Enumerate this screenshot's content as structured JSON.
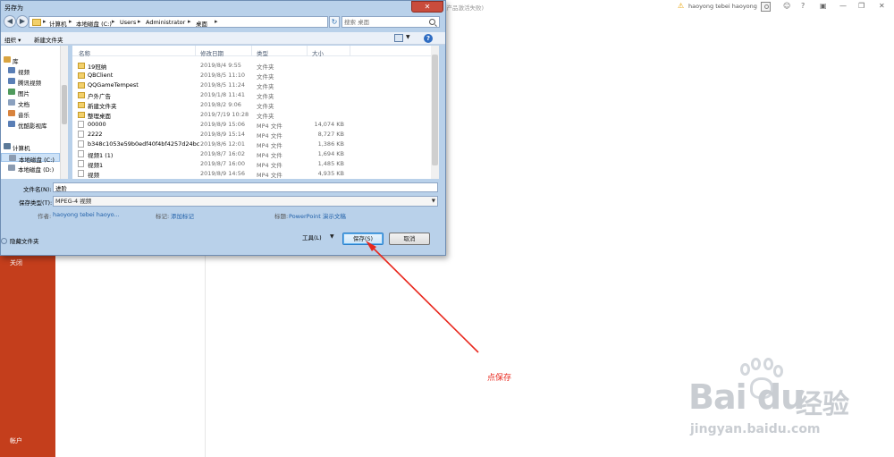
{
  "ppt": {
    "doc_title": "(产品激活失败)",
    "user_name": "haoyong tebei haoyong",
    "sidebar": {
      "close_label": "关闭",
      "account_label": "帐户"
    }
  },
  "dialog": {
    "title": "另存为",
    "address": {
      "crumbs": [
        "计算机",
        "本地磁盘 (C:)",
        "Users",
        "Administrator",
        "桌面"
      ]
    },
    "search_placeholder": "搜索 桌面",
    "toolbar": {
      "organize": "组织 ▾",
      "new_folder": "新建文件夹"
    },
    "nav": {
      "items": [
        {
          "label": "库",
          "icon": "library-icon",
          "top": true
        },
        {
          "label": "视频",
          "icon": "video-icon"
        },
        {
          "label": "腾讯视频",
          "icon": "video-icon"
        },
        {
          "label": "图片",
          "icon": "picture-icon"
        },
        {
          "label": "文档",
          "icon": "document-icon"
        },
        {
          "label": "音乐",
          "icon": "music-icon"
        },
        {
          "label": "优酷影视库",
          "icon": "video-icon"
        },
        {
          "label": "计算机",
          "icon": "computer-icon",
          "top": true
        },
        {
          "label": "本地磁盘 (C:)",
          "icon": "drive-icon",
          "selected": true
        },
        {
          "label": "本地磁盘 (D:)",
          "icon": "drive-icon"
        }
      ]
    },
    "list": {
      "headers": {
        "name": "名称",
        "date": "修改日期",
        "type": "类型",
        "size": "大小"
      },
      "rows": [
        {
          "name": "19冠纳",
          "date": "2019/8/4 9:55",
          "type": "文件夹",
          "size": "",
          "kind": "folder"
        },
        {
          "name": "QBClient",
          "date": "2019/8/5 11:10",
          "type": "文件夹",
          "size": "",
          "kind": "folder"
        },
        {
          "name": "QQGameTempest",
          "date": "2019/8/5 11:24",
          "type": "文件夹",
          "size": "",
          "kind": "folder"
        },
        {
          "name": "户外广告",
          "date": "2019/1/8 11:41",
          "type": "文件夹",
          "size": "",
          "kind": "folder"
        },
        {
          "name": "新建文件夹",
          "date": "2019/8/2 9:06",
          "type": "文件夹",
          "size": "",
          "kind": "folder"
        },
        {
          "name": "整理桌面",
          "date": "2019/7/19 10:28",
          "type": "文件夹",
          "size": "",
          "kind": "folder"
        },
        {
          "name": "00000",
          "date": "2019/8/9 15:06",
          "type": "MP4 文件",
          "size": "14,074 KB",
          "kind": "file"
        },
        {
          "name": "2222",
          "date": "2019/8/9 15:14",
          "type": "MP4 文件",
          "size": "8,727 KB",
          "kind": "file"
        },
        {
          "name": "b348c1053e59b0edf40f4bf4257d24bc",
          "date": "2019/8/6 12:01",
          "type": "MP4 文件",
          "size": "1,386 KB",
          "kind": "file"
        },
        {
          "name": "视频1 (1)",
          "date": "2019/8/7 16:02",
          "type": "MP4 文件",
          "size": "1,694 KB",
          "kind": "file"
        },
        {
          "name": "视频1",
          "date": "2019/8/7 16:00",
          "type": "MP4 文件",
          "size": "1,485 KB",
          "kind": "file"
        },
        {
          "name": "视频",
          "date": "2019/8/9 14:56",
          "type": "MP4 文件",
          "size": "4,935 KB",
          "kind": "file"
        }
      ]
    },
    "form": {
      "filename_label": "文件名(N):",
      "filename_value": "进阶",
      "filetype_label": "保存类型(T):",
      "filetype_value": "MPEG-4 视频",
      "author_label": "作者:",
      "author_value": "haoyong tebei haoyo...",
      "tags_label": "标记:",
      "tags_value": "添加标记",
      "title_label": "标题:",
      "title_value": "PowerPoint 演示文稿"
    },
    "footer": {
      "hide_folders": "隐藏文件夹",
      "tools": "工具(L)",
      "save": "保存(S)",
      "cancel": "取消"
    }
  },
  "annotation": {
    "text": "点保存",
    "color": "#e8281e"
  },
  "watermark": {
    "logo": "Bai du",
    "cn": "经验",
    "url": "jingyan.baidu.com"
  },
  "colors": {
    "ppt_accent": "#c43e1c",
    "dialog_chrome": "#b9d1ea",
    "close_button": "#c94c3c"
  }
}
